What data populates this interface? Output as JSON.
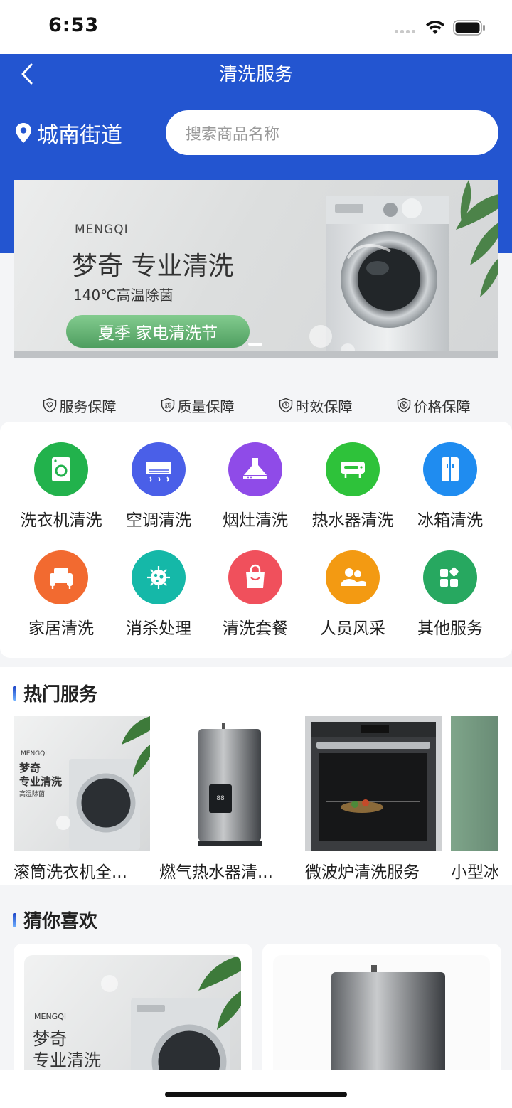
{
  "status_bar": {
    "time": "6:53"
  },
  "nav": {
    "title": "清洗服务"
  },
  "location": {
    "label": "城南街道"
  },
  "search": {
    "placeholder": "搜索商品名称"
  },
  "banner": {
    "brand": "MENGQI",
    "title": "梦奇 专业清洗",
    "subtitle": "140℃高温除菌",
    "pill": "夏季 家电清洗节"
  },
  "guarantees": [
    {
      "label": "服务保障",
      "icon": "shield-heart-icon"
    },
    {
      "label": "质量保障",
      "icon": "quality-badge-icon"
    },
    {
      "label": "时效保障",
      "icon": "clock-badge-icon"
    },
    {
      "label": "价格保障",
      "icon": "yen-badge-icon"
    }
  ],
  "categories": [
    {
      "label": "洗衣机清洗",
      "icon": "washing-machine-icon",
      "color": "#22b24c"
    },
    {
      "label": "空调清洗",
      "icon": "air-conditioner-icon",
      "color": "#4a5fe8"
    },
    {
      "label": "烟灶清洗",
      "icon": "range-hood-icon",
      "color": "#8f4be8"
    },
    {
      "label": "热水器清洗",
      "icon": "water-heater-icon",
      "color": "#2ec23a"
    },
    {
      "label": "冰箱清洗",
      "icon": "refrigerator-icon",
      "color": "#1f8cf0"
    },
    {
      "label": "家居清洗",
      "icon": "sofa-icon",
      "color": "#f26a30"
    },
    {
      "label": "消杀处理",
      "icon": "virus-icon",
      "color": "#15b8a8"
    },
    {
      "label": "清洗套餐",
      "icon": "shopping-bag-icon",
      "color": "#f0505c"
    },
    {
      "label": "人员风采",
      "icon": "people-icon",
      "color": "#f39a12"
    },
    {
      "label": "其他服务",
      "icon": "apps-icon",
      "color": "#27a860"
    }
  ],
  "hot_services": {
    "title": "热门服务",
    "items": [
      {
        "name": "滚筒洗衣机全...",
        "img_text_brand": "MENGQI",
        "img_text_title1": "梦奇",
        "img_text_title2": "专业清洗",
        "img_text_sub": "高温除菌"
      },
      {
        "name": "燃气热水器清..."
      },
      {
        "name": "微波炉清洗服务"
      },
      {
        "name": "小型冰"
      }
    ]
  },
  "guess_like": {
    "title": "猜你喜欢",
    "items": [
      {
        "img_text_brand": "MENGQI",
        "img_text_title1": "梦奇",
        "img_text_title2": "专业清洗"
      },
      {
        "img_text_brand": ""
      }
    ]
  }
}
